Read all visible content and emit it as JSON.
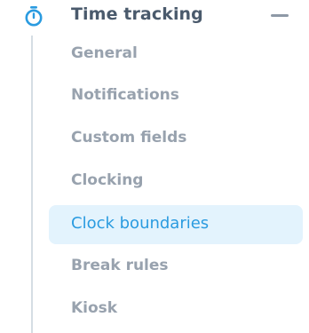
{
  "section": {
    "title": "Time tracking",
    "icon": "stopwatch-icon",
    "collapse_icon": "minus-icon",
    "accent_color": "#2a9be0"
  },
  "items": [
    {
      "label": "General"
    },
    {
      "label": "Notifications"
    },
    {
      "label": "Custom fields"
    },
    {
      "label": "Clocking"
    },
    {
      "label": "Clock boundaries",
      "active": true
    },
    {
      "label": "Break rules"
    },
    {
      "label": "Kiosk"
    }
  ]
}
